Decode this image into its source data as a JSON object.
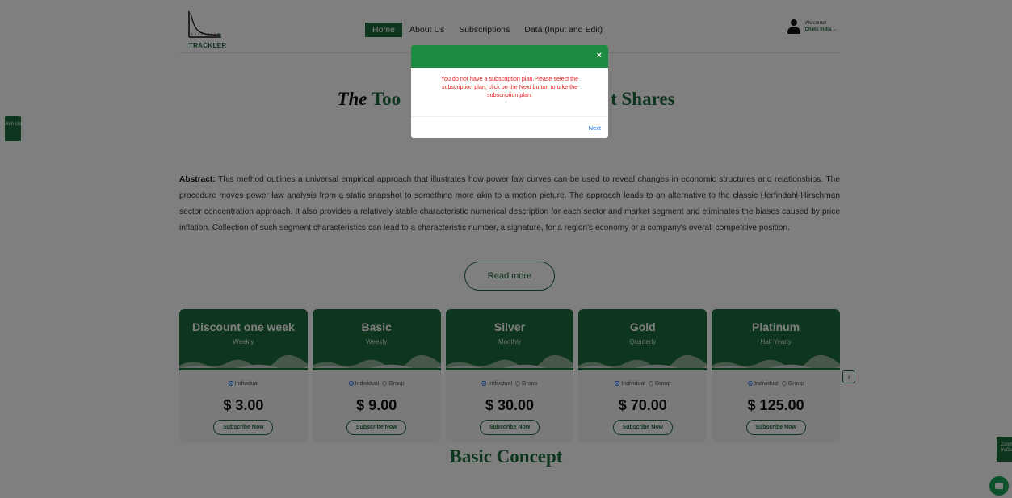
{
  "header": {
    "logo_text": "TRACKLER",
    "nav": [
      "Home",
      "About Us",
      "Subscriptions",
      "Data (Input and Edit)"
    ],
    "active_nav": "Home",
    "user": {
      "greeting": "Welcome!",
      "name": "Chetu India ⌄"
    }
  },
  "side": {
    "join_label": "Join Us",
    "zoom_label": "Zoom In/Out"
  },
  "hero": {
    "title_em": "The",
    "title_rest": "Too",
    "title_end": "t Shares"
  },
  "abstract": {
    "label": "Abstract:",
    "text": " This method outlines a universal empirical approach that illustrates how power law curves can be used to reveal changes in economic structures and relationships. The procedure moves power law analysis from a static snapshot to something more akin to a motion picture. The approach leads to an alternative to the classic Herfindahl-Hirschman sector concentration approach. It also provides a relatively stable characteristic numerical description for each sector and market segment and eliminates the biases caused by price inflation. Collection of such segment characteristics can lead to a characteristic number, a signature, for a region's economy or a company's overall competitive position.",
    "read_more": "Read more"
  },
  "plans": [
    {
      "name": "Discount one week",
      "period": "Weekly",
      "individual": "Individual",
      "group": "",
      "price": "$ 3.00",
      "button": "Subscribe Now"
    },
    {
      "name": "Basic",
      "period": "Weekly",
      "individual": "Individual",
      "group": "Group",
      "price": "$ 9.00",
      "button": "Subscribe Now"
    },
    {
      "name": "Silver",
      "period": "Monthly",
      "individual": "Individual",
      "group": "Group",
      "price": "$ 30.00",
      "button": "Subscribe Now"
    },
    {
      "name": "Gold",
      "period": "Quarterly",
      "individual": "Individual",
      "group": "Group",
      "price": "$ 70.00",
      "button": "Subscribe Now"
    },
    {
      "name": "Platinum",
      "period": "Half Yearly",
      "individual": "Individual",
      "group": "Group",
      "price": "$ 125.00",
      "button": "Subscribe Now"
    }
  ],
  "carousel": {
    "next_glyph": "›"
  },
  "section": {
    "title": "Basic Concept"
  },
  "modal": {
    "close_glyph": "×",
    "message": "You do not have a subscription plan.Please select the subscription plan, click on the Next button to take the subscription plan.",
    "next_label": "Next"
  },
  "colors": {
    "brand": "#1d6b3a",
    "modal_header": "#1d8b40",
    "error": "#e02020",
    "link": "#1a73e8"
  },
  "icons": {
    "user": "user-icon",
    "chat": "chat-icon",
    "close": "close-icon",
    "chevron": "chevron-right-icon"
  }
}
